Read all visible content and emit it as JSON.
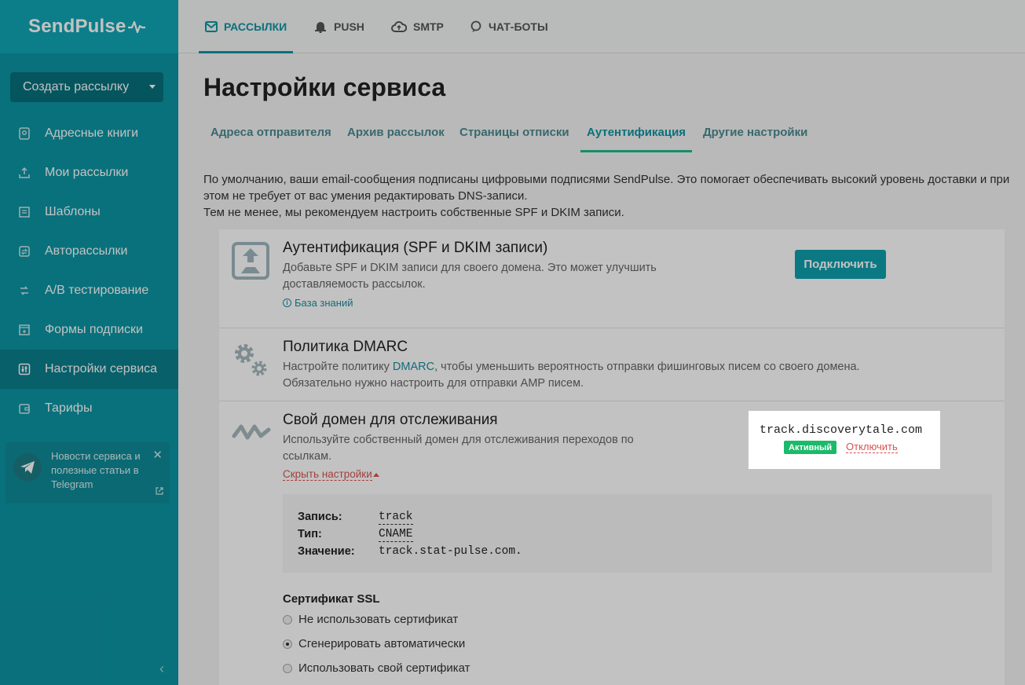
{
  "app": {
    "logo": "SendPulse"
  },
  "sidebar": {
    "create_button": "Создать рассылку",
    "items": [
      {
        "label": "Адресные книги",
        "icon": "address-book-icon"
      },
      {
        "label": "Мои рассылки",
        "icon": "upload-icon"
      },
      {
        "label": "Шаблоны",
        "icon": "template-icon"
      },
      {
        "label": "Авторассылки",
        "icon": "automation-icon"
      },
      {
        "label": "A/B тестирование",
        "icon": "ab-test-icon"
      },
      {
        "label": "Формы подписки",
        "icon": "form-icon"
      },
      {
        "label": "Настройки сервиса",
        "icon": "settings-sliders-icon",
        "active": true
      },
      {
        "label": "Тарифы",
        "icon": "wallet-icon"
      }
    ],
    "promo": {
      "text": "Новости сервиса и полезные статьи в Telegram"
    }
  },
  "topnav": {
    "tabs": [
      {
        "label": "РАССЫЛКИ",
        "icon": "mail-icon",
        "active": true
      },
      {
        "label": "PUSH",
        "icon": "bell-icon"
      },
      {
        "label": "SMTP",
        "icon": "cloud-icon"
      },
      {
        "label": "ЧАТ-БОТЫ",
        "icon": "chat-icon"
      }
    ]
  },
  "page": {
    "title": "Настройки сервиса",
    "subtabs": [
      {
        "label": "Адреса отправителя"
      },
      {
        "label": "Архив рассылок"
      },
      {
        "label": "Страницы отписки"
      },
      {
        "label": "Аутентификация",
        "active": true
      },
      {
        "label": "Другие настройки"
      }
    ],
    "intro_line1": "По умолчанию, ваши email-сообщения подписаны цифровыми подписями SendPulse. Это помогает обеспечивать высокий уровень доставки и при этом не требует от вас умения редактировать DNS-записи.",
    "intro_line2": "Тем не менее, мы рекомендуем настроить собственные SPF и DKIM записи."
  },
  "auth": {
    "title": "Аутентификация (SPF и DKIM записи)",
    "desc": "Добавьте SPF и DKIM записи для своего домена. Это может улучшить доставляемость рассылок.",
    "kb_link": "База знаний",
    "button": "Подключить"
  },
  "dmarc": {
    "title": "Политика DMARC",
    "desc_before": "Настройте политику ",
    "desc_link": "DMARC",
    "desc_after": ", чтобы уменьшить вероятность отправки фишинговых писем со своего домена.",
    "desc_line2": "Обязательно нужно настроить для отправки AMP писем."
  },
  "tracking": {
    "title": "Свой домен для отслеживания",
    "desc": "Используйте собственный домен для отслеживания переходов по ссылкам.",
    "hide_link": "Скрыть настройки",
    "domain": "track.discoverytale.com",
    "status": "Активный",
    "disable": "Отключить",
    "record": {
      "record_label": "Запись:",
      "record_value": "track",
      "type_label": "Тип:",
      "type_value": "CNAME",
      "value_label": "Значение:",
      "value_value": "track.stat-pulse.com."
    },
    "ssl": {
      "title": "Сертификат SSL",
      "options": [
        {
          "label": "Не использовать сертификат",
          "selected": false
        },
        {
          "label": "Сгенерировать автоматически",
          "selected": true
        },
        {
          "label": "Использовать свой сертификат",
          "selected": false
        }
      ]
    }
  },
  "colors": {
    "brand": "#0d95a3",
    "active_green": "#1bba6b",
    "danger": "#d9534f"
  }
}
